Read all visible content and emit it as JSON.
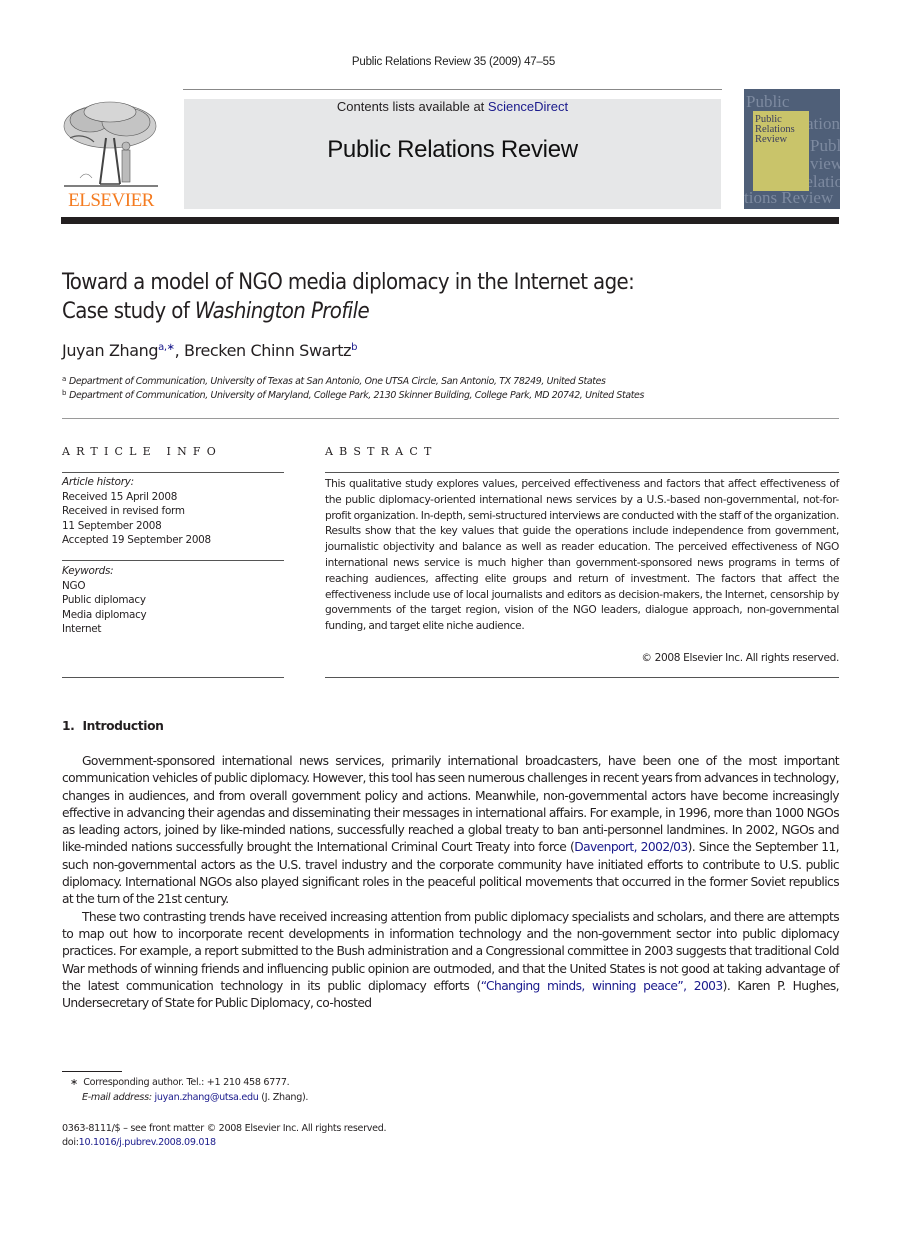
{
  "running_head": "Public Relations Review 35 (2009) 47–55",
  "masthead": {
    "contents_prefix": "Contents lists available at ",
    "contents_link": "ScienceDirect",
    "journal_name": "Public Relations Review",
    "publisher_logo_text": "ELSEVIER",
    "cover": {
      "title_lines": [
        "Public",
        "Relations",
        "Review"
      ],
      "background_words": [
        "Public",
        "ations",
        "Publi",
        "view",
        "Relatio",
        "tions Review"
      ]
    }
  },
  "article": {
    "title_line1": "Toward a model of NGO media diplomacy in the Internet age:",
    "title_line2_prefix": "Case study of ",
    "title_line2_italic": "Washington Profile",
    "authors": [
      {
        "name": "Juyan Zhang",
        "marks": "a,∗"
      },
      {
        "name": "Brecken Chinn Swartz",
        "marks": "b"
      }
    ],
    "affiliations": [
      {
        "mark": "a",
        "text": "Department of Communication, University of Texas at San Antonio, One UTSA Circle, San Antonio, TX 78249, United States"
      },
      {
        "mark": "b",
        "text": "Department of Communication, University of Maryland, College Park, 2130 Skinner Building, College Park, MD 20742, United States"
      }
    ]
  },
  "article_info": {
    "heading": "ARTICLE INFO",
    "history_label": "Article history:",
    "history": [
      "Received 15 April 2008",
      "Received in revised form",
      "11 September 2008",
      "Accepted 19 September 2008"
    ],
    "keywords_label": "Keywords:",
    "keywords": [
      "NGO",
      "Public diplomacy",
      "Media diplomacy",
      "Internet"
    ]
  },
  "abstract": {
    "heading": "ABSTRACT",
    "text": "This qualitative study explores values, perceived effectiveness and factors that affect effectiveness of the public diplomacy-oriented international news services by a U.S.-based non-governmental, not-for-profit organization. In-depth, semi-structured interviews are conducted with the staff of the organization. Results show that the key values that guide the operations include independence from government, journalistic objectivity and balance as well as reader education. The perceived effectiveness of NGO international news service is much higher than government-sponsored news programs in terms of reaching audiences, affecting elite groups and return of investment. The factors that affect the effectiveness include use of local journalists and editors as decision-makers, the Internet, censorship by governments of the target region, vision of the NGO leaders, dialogue approach, non-governmental funding, and target elite niche audience.",
    "copyright": "© 2008 Elsevier Inc. All rights reserved."
  },
  "introduction": {
    "number": "1.",
    "heading": "Introduction",
    "p1_a": "Government-sponsored international news services, primarily international broadcasters, have been one of the most important communication vehicles of public diplomacy. However, this tool has seen numerous challenges in recent years from advances in technology, changes in audiences, and from overall government policy and actions. Meanwhile, non-governmental actors have become increasingly effective in advancing their agendas and disseminating their messages in international affairs. For example, in 1996, more than 1000 NGOs as leading actors, joined by like-minded nations, successfully reached a global treaty to ban anti-personnel landmines. In 2002, NGOs and like-minded nations successfully brought the International Criminal Court Treaty into force (",
    "p1_cite": "Davenport, 2002/03",
    "p1_b": "). Since the September 11, such non-governmental actors as the U.S. travel industry and the corporate community have initiated efforts to contribute to U.S. public diplomacy. International NGOs also played significant roles in the peaceful political movements that occurred in the former Soviet republics at the turn of the 21st century.",
    "p2_a": "These two contrasting trends have received increasing attention from public diplomacy specialists and scholars, and there are attempts to map out how to incorporate recent developments in information technology and the non-government sector into public diplomacy practices. For example, a report submitted to the Bush administration and a Congressional committee in 2003 suggests that traditional Cold War methods of winning friends and influencing public opinion are outmoded, and that the United States is not good at taking advantage of the latest communication technology in its public diplomacy efforts (",
    "p2_cite": "“Changing minds, winning peace”, 2003",
    "p2_b": "). Karen P. Hughes, Undersecretary of State for Public Diplomacy, co-hosted"
  },
  "footnotes": {
    "corresponding_mark": "∗",
    "corresponding_text": "Corresponding author. Tel.: +1 210 458 6777.",
    "email_label": "E-mail address:",
    "email": "juyan.zhang@utsa.edu",
    "email_suffix": " (J. Zhang).",
    "front_matter": "0363-8111/$ – see front matter © 2008 Elsevier Inc. All rights reserved.",
    "doi_label": "doi:",
    "doi": "10.1016/j.pubrev.2008.09.018"
  },
  "colors": {
    "link": "#1a1a8c",
    "elsevier_orange": "#f47b20",
    "masthead_gray": "#e6e7e8"
  }
}
